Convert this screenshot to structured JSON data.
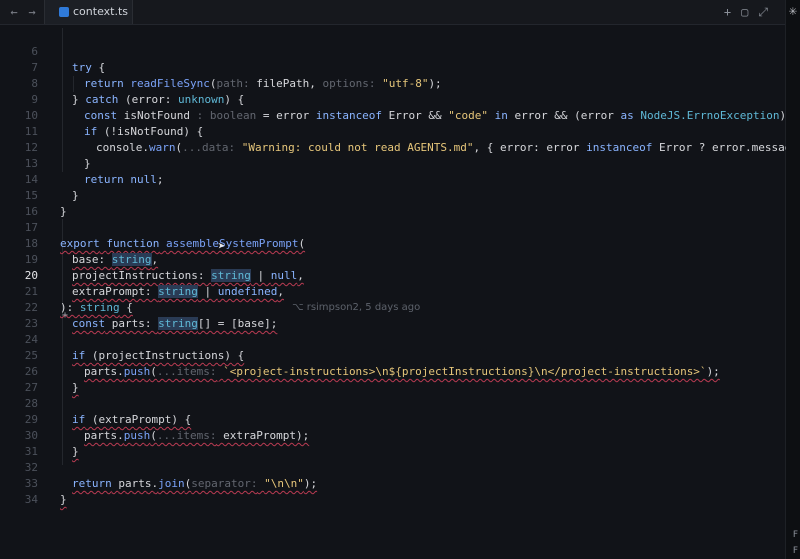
{
  "tab": {
    "label": "context.ts"
  },
  "blame": "rsimpson2, 5 days ago",
  "lines": [
    {
      "n": "6",
      "t": "try {"
    },
    {
      "n": "7",
      "t": "return readFileSync(path: filePath, options: \"utf-8\");"
    },
    {
      "n": "8",
      "t": "} catch (error: unknown) {"
    },
    {
      "n": "9",
      "t": "const isNotFound : boolean = error instanceof Error && \"code\" in error && (error as NodeJS.ErrnoException).code === \"ENO"
    },
    {
      "n": "10",
      "t": "if (!isNotFound) {"
    },
    {
      "n": "11",
      "t": "console.warn(...data: \"Warning: could not read AGENTS.md\", { error: error instanceof Error ? error.message : String(va"
    },
    {
      "n": "12",
      "t": "}"
    },
    {
      "n": "13",
      "t": "return null;"
    },
    {
      "n": "14",
      "t": "}"
    },
    {
      "n": "15",
      "t": "}"
    },
    {
      "n": "16",
      "t": ""
    },
    {
      "n": "17",
      "t": "export function assembleSystemPrompt("
    },
    {
      "n": "18",
      "t": "base: string,"
    },
    {
      "n": "19",
      "t": "projectInstructions: string | null,"
    },
    {
      "n": "20",
      "t": "extraPrompt: string | undefined,"
    },
    {
      "n": "21",
      "t": "): string {"
    },
    {
      "n": "22",
      "t": "const parts: string[] = [base];"
    },
    {
      "n": "23",
      "t": ""
    },
    {
      "n": "24",
      "t": "if (projectInstructions) {"
    },
    {
      "n": "25",
      "t": "parts.push(...items: `<project-instructions>\\n${projectInstructions}\\n</project-instructions>`);"
    },
    {
      "n": "26",
      "t": "}"
    },
    {
      "n": "27",
      "t": ""
    },
    {
      "n": "28",
      "t": "if (extraPrompt) {"
    },
    {
      "n": "29",
      "t": "parts.push(...items: extraPrompt);"
    },
    {
      "n": "30",
      "t": "}"
    },
    {
      "n": "31",
      "t": ""
    },
    {
      "n": "32",
      "t": "return parts.join(separator: \"\\n\\n\");"
    },
    {
      "n": "33",
      "t": "}"
    },
    {
      "n": "34",
      "t": ""
    }
  ]
}
